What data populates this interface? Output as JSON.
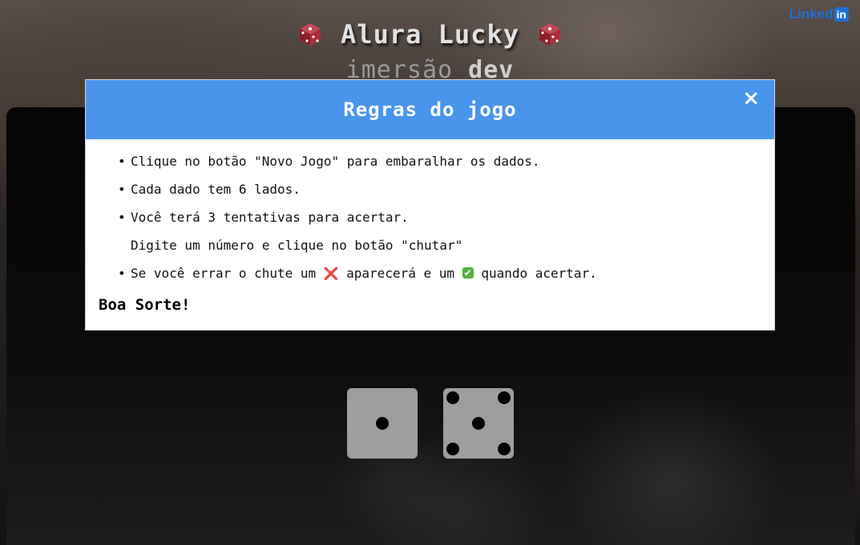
{
  "header": {
    "title": "Alura Lucky",
    "subtitle_light": "imersão",
    "subtitle_bold": "dev",
    "linkedin_text": "Linked",
    "linkedin_in": "in"
  },
  "modal": {
    "title": "Regras do jogo",
    "close_label": "×",
    "rules": [
      "Clique no botão \"Novo Jogo\" para embaralhar os dados.",
      "Cada dado tem 6 lados.",
      "Você terá 3 tentativas para acertar.",
      "Digite um número e clique no botão \"chutar\""
    ],
    "rule5": {
      "part1": "Se você errar o chute um ",
      "mark_wrong": "❌",
      "part2": " aparecerá e um ",
      "mark_right": "✔",
      "part3": " quando acertar."
    },
    "closing": "Boa Sorte!"
  },
  "dice": {
    "die1_value": 1,
    "die2_value": 5
  },
  "colors": {
    "modal_header": "#4a95ec",
    "die_face": "#9e9e9e",
    "die_icon": "#8b1e2a",
    "linkedin": "#1d6fd6"
  },
  "icons": {
    "title_left": "die-icon",
    "title_right": "die-icon",
    "close": "close-icon"
  }
}
